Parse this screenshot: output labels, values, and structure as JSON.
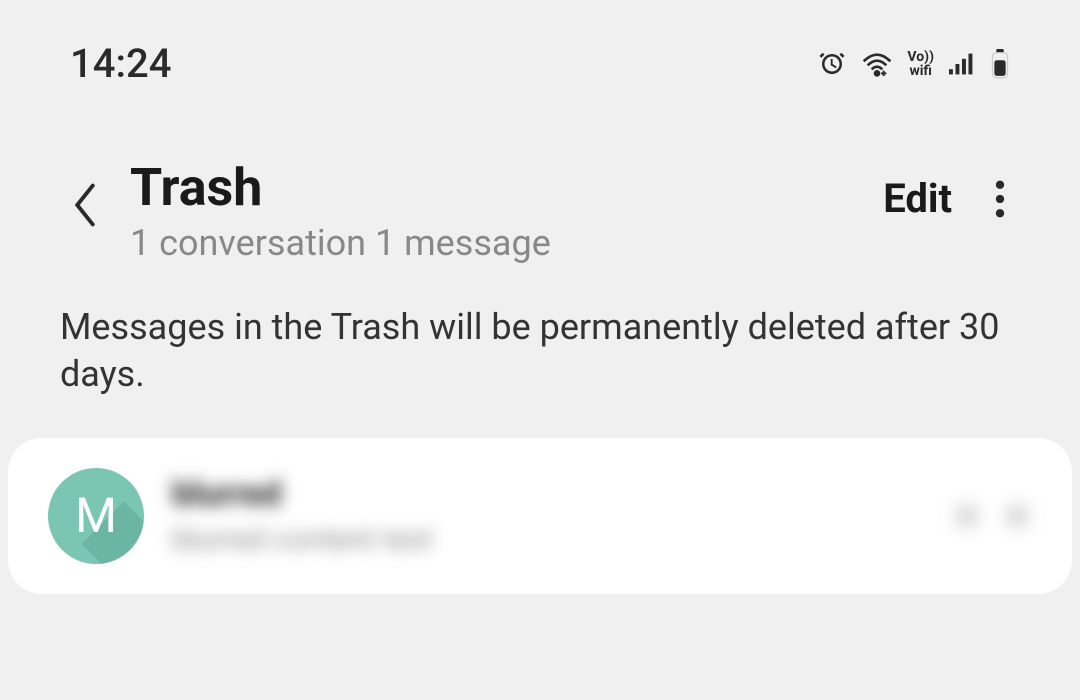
{
  "status_bar": {
    "time": "14:24",
    "vowifi_top": "Vo))",
    "vowifi_bottom": "wifi"
  },
  "header": {
    "title": "Trash",
    "subtitle": "1 conversation 1 message",
    "edit_label": "Edit"
  },
  "info_text": "Messages in the Trash will be permanently deleted after 30 days.",
  "conversations": [
    {
      "avatar_letter": "M",
      "title": "blurred",
      "preview": "blurred content text"
    }
  ]
}
